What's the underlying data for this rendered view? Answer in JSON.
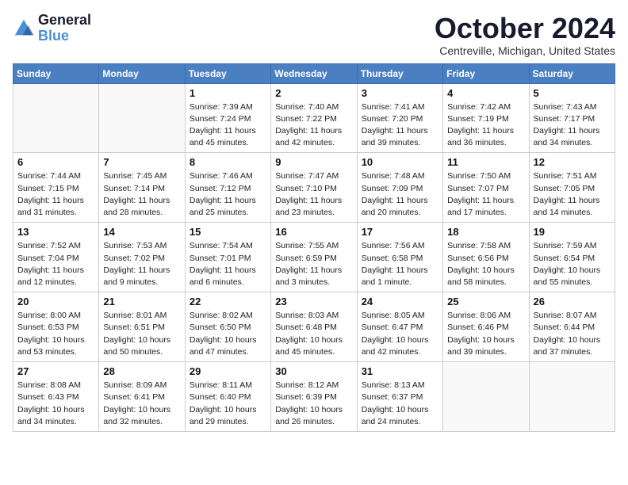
{
  "logo": {
    "line1": "General",
    "line2": "Blue"
  },
  "title": "October 2024",
  "location": "Centreville, Michigan, United States",
  "weekdays": [
    "Sunday",
    "Monday",
    "Tuesday",
    "Wednesday",
    "Thursday",
    "Friday",
    "Saturday"
  ],
  "weeks": [
    [
      {
        "day": "",
        "sunrise": "",
        "sunset": "",
        "daylight": ""
      },
      {
        "day": "",
        "sunrise": "",
        "sunset": "",
        "daylight": ""
      },
      {
        "day": "1",
        "sunrise": "Sunrise: 7:39 AM",
        "sunset": "Sunset: 7:24 PM",
        "daylight": "Daylight: 11 hours and 45 minutes."
      },
      {
        "day": "2",
        "sunrise": "Sunrise: 7:40 AM",
        "sunset": "Sunset: 7:22 PM",
        "daylight": "Daylight: 11 hours and 42 minutes."
      },
      {
        "day": "3",
        "sunrise": "Sunrise: 7:41 AM",
        "sunset": "Sunset: 7:20 PM",
        "daylight": "Daylight: 11 hours and 39 minutes."
      },
      {
        "day": "4",
        "sunrise": "Sunrise: 7:42 AM",
        "sunset": "Sunset: 7:19 PM",
        "daylight": "Daylight: 11 hours and 36 minutes."
      },
      {
        "day": "5",
        "sunrise": "Sunrise: 7:43 AM",
        "sunset": "Sunset: 7:17 PM",
        "daylight": "Daylight: 11 hours and 34 minutes."
      }
    ],
    [
      {
        "day": "6",
        "sunrise": "Sunrise: 7:44 AM",
        "sunset": "Sunset: 7:15 PM",
        "daylight": "Daylight: 11 hours and 31 minutes."
      },
      {
        "day": "7",
        "sunrise": "Sunrise: 7:45 AM",
        "sunset": "Sunset: 7:14 PM",
        "daylight": "Daylight: 11 hours and 28 minutes."
      },
      {
        "day": "8",
        "sunrise": "Sunrise: 7:46 AM",
        "sunset": "Sunset: 7:12 PM",
        "daylight": "Daylight: 11 hours and 25 minutes."
      },
      {
        "day": "9",
        "sunrise": "Sunrise: 7:47 AM",
        "sunset": "Sunset: 7:10 PM",
        "daylight": "Daylight: 11 hours and 23 minutes."
      },
      {
        "day": "10",
        "sunrise": "Sunrise: 7:48 AM",
        "sunset": "Sunset: 7:09 PM",
        "daylight": "Daylight: 11 hours and 20 minutes."
      },
      {
        "day": "11",
        "sunrise": "Sunrise: 7:50 AM",
        "sunset": "Sunset: 7:07 PM",
        "daylight": "Daylight: 11 hours and 17 minutes."
      },
      {
        "day": "12",
        "sunrise": "Sunrise: 7:51 AM",
        "sunset": "Sunset: 7:05 PM",
        "daylight": "Daylight: 11 hours and 14 minutes."
      }
    ],
    [
      {
        "day": "13",
        "sunrise": "Sunrise: 7:52 AM",
        "sunset": "Sunset: 7:04 PM",
        "daylight": "Daylight: 11 hours and 12 minutes."
      },
      {
        "day": "14",
        "sunrise": "Sunrise: 7:53 AM",
        "sunset": "Sunset: 7:02 PM",
        "daylight": "Daylight: 11 hours and 9 minutes."
      },
      {
        "day": "15",
        "sunrise": "Sunrise: 7:54 AM",
        "sunset": "Sunset: 7:01 PM",
        "daylight": "Daylight: 11 hours and 6 minutes."
      },
      {
        "day": "16",
        "sunrise": "Sunrise: 7:55 AM",
        "sunset": "Sunset: 6:59 PM",
        "daylight": "Daylight: 11 hours and 3 minutes."
      },
      {
        "day": "17",
        "sunrise": "Sunrise: 7:56 AM",
        "sunset": "Sunset: 6:58 PM",
        "daylight": "Daylight: 11 hours and 1 minute."
      },
      {
        "day": "18",
        "sunrise": "Sunrise: 7:58 AM",
        "sunset": "Sunset: 6:56 PM",
        "daylight": "Daylight: 10 hours and 58 minutes."
      },
      {
        "day": "19",
        "sunrise": "Sunrise: 7:59 AM",
        "sunset": "Sunset: 6:54 PM",
        "daylight": "Daylight: 10 hours and 55 minutes."
      }
    ],
    [
      {
        "day": "20",
        "sunrise": "Sunrise: 8:00 AM",
        "sunset": "Sunset: 6:53 PM",
        "daylight": "Daylight: 10 hours and 53 minutes."
      },
      {
        "day": "21",
        "sunrise": "Sunrise: 8:01 AM",
        "sunset": "Sunset: 6:51 PM",
        "daylight": "Daylight: 10 hours and 50 minutes."
      },
      {
        "day": "22",
        "sunrise": "Sunrise: 8:02 AM",
        "sunset": "Sunset: 6:50 PM",
        "daylight": "Daylight: 10 hours and 47 minutes."
      },
      {
        "day": "23",
        "sunrise": "Sunrise: 8:03 AM",
        "sunset": "Sunset: 6:48 PM",
        "daylight": "Daylight: 10 hours and 45 minutes."
      },
      {
        "day": "24",
        "sunrise": "Sunrise: 8:05 AM",
        "sunset": "Sunset: 6:47 PM",
        "daylight": "Daylight: 10 hours and 42 minutes."
      },
      {
        "day": "25",
        "sunrise": "Sunrise: 8:06 AM",
        "sunset": "Sunset: 6:46 PM",
        "daylight": "Daylight: 10 hours and 39 minutes."
      },
      {
        "day": "26",
        "sunrise": "Sunrise: 8:07 AM",
        "sunset": "Sunset: 6:44 PM",
        "daylight": "Daylight: 10 hours and 37 minutes."
      }
    ],
    [
      {
        "day": "27",
        "sunrise": "Sunrise: 8:08 AM",
        "sunset": "Sunset: 6:43 PM",
        "daylight": "Daylight: 10 hours and 34 minutes."
      },
      {
        "day": "28",
        "sunrise": "Sunrise: 8:09 AM",
        "sunset": "Sunset: 6:41 PM",
        "daylight": "Daylight: 10 hours and 32 minutes."
      },
      {
        "day": "29",
        "sunrise": "Sunrise: 8:11 AM",
        "sunset": "Sunset: 6:40 PM",
        "daylight": "Daylight: 10 hours and 29 minutes."
      },
      {
        "day": "30",
        "sunrise": "Sunrise: 8:12 AM",
        "sunset": "Sunset: 6:39 PM",
        "daylight": "Daylight: 10 hours and 26 minutes."
      },
      {
        "day": "31",
        "sunrise": "Sunrise: 8:13 AM",
        "sunset": "Sunset: 6:37 PM",
        "daylight": "Daylight: 10 hours and 24 minutes."
      },
      {
        "day": "",
        "sunrise": "",
        "sunset": "",
        "daylight": ""
      },
      {
        "day": "",
        "sunrise": "",
        "sunset": "",
        "daylight": ""
      }
    ]
  ]
}
